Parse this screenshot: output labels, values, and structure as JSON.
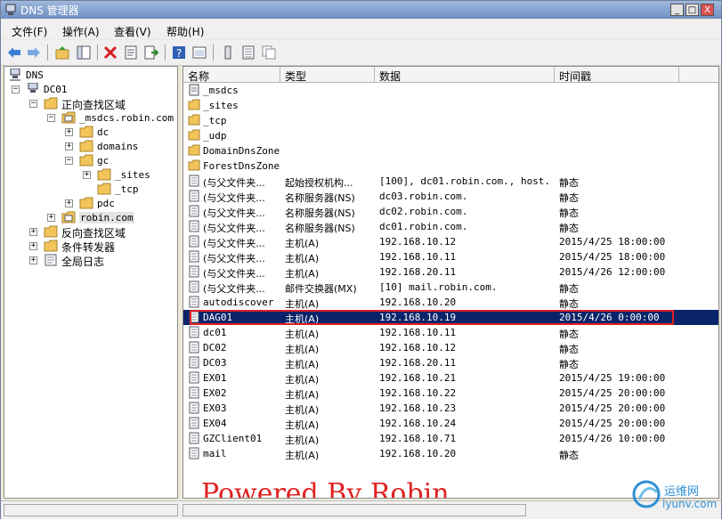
{
  "window": {
    "title": "DNS 管理器",
    "buttons": [
      "_",
      "□",
      "X"
    ]
  },
  "menubar": [
    "文件(F)",
    "操作(A)",
    "查看(V)",
    "帮助(H)"
  ],
  "toolbar_icons": [
    "back-icon",
    "forward-icon",
    "up-folder-icon",
    "show-tree-icon",
    "delete-icon",
    "properties-icon",
    "export-icon",
    "help-icon",
    "console-icon",
    "server-icon",
    "list-icon",
    "copy-icon"
  ],
  "tree": {
    "root": "DNS",
    "server": "DC01",
    "forward_zones": "正向查找区域",
    "msdcs": "_msdcs.robin.com",
    "dc": "dc",
    "domains": "domains",
    "gc": "gc",
    "gc_sites": "_sites",
    "gc_tcp": "_tcp",
    "pdc": "pdc",
    "robin": "robin.com",
    "reverse_zones": "反向查找区域",
    "conditional": "条件转发器",
    "global_logs": "全局日志"
  },
  "list": {
    "headers": [
      "名称",
      "类型",
      "数据",
      "时间戳"
    ],
    "rows": [
      {
        "kind": "folder-special",
        "name": "_msdcs",
        "type": "",
        "data": "",
        "ts": ""
      },
      {
        "kind": "folder",
        "name": "_sites",
        "type": "",
        "data": "",
        "ts": ""
      },
      {
        "kind": "folder",
        "name": "_tcp",
        "type": "",
        "data": "",
        "ts": ""
      },
      {
        "kind": "folder",
        "name": "_udp",
        "type": "",
        "data": "",
        "ts": ""
      },
      {
        "kind": "folder",
        "name": "DomainDnsZones",
        "type": "",
        "data": "",
        "ts": ""
      },
      {
        "kind": "folder",
        "name": "ForestDnsZones",
        "type": "",
        "data": "",
        "ts": ""
      },
      {
        "kind": "record",
        "name": "(与父文件夹...",
        "type": "起始授权机构...",
        "data": "[100], dc01.robin.com., host...",
        "ts": "静态"
      },
      {
        "kind": "record",
        "name": "(与父文件夹...",
        "type": "名称服务器(NS)",
        "data": "dc03.robin.com.",
        "ts": "静态"
      },
      {
        "kind": "record",
        "name": "(与父文件夹...",
        "type": "名称服务器(NS)",
        "data": "dc02.robin.com.",
        "ts": "静态"
      },
      {
        "kind": "record",
        "name": "(与父文件夹...",
        "type": "名称服务器(NS)",
        "data": "dc01.robin.com.",
        "ts": "静态"
      },
      {
        "kind": "record",
        "name": "(与父文件夹...",
        "type": "主机(A)",
        "data": "192.168.10.12",
        "ts": "2015/4/25 18:00:00"
      },
      {
        "kind": "record",
        "name": "(与父文件夹...",
        "type": "主机(A)",
        "data": "192.168.10.11",
        "ts": "2015/4/25 18:00:00"
      },
      {
        "kind": "record",
        "name": "(与父文件夹...",
        "type": "主机(A)",
        "data": "192.168.20.11",
        "ts": "2015/4/26 12:00:00"
      },
      {
        "kind": "record",
        "name": "(与父文件夹...",
        "type": "邮件交换器(MX)",
        "data": "[10]  mail.robin.com.",
        "ts": "静态"
      },
      {
        "kind": "record",
        "name": "autodiscover",
        "type": "主机(A)",
        "data": "192.168.10.20",
        "ts": "静态"
      },
      {
        "kind": "record",
        "name": "DAG01",
        "type": "主机(A)",
        "data": "192.168.10.19",
        "ts": "2015/4/26 0:00:00",
        "selected": true
      },
      {
        "kind": "record",
        "name": "dc01",
        "type": "主机(A)",
        "data": "192.168.10.11",
        "ts": "静态"
      },
      {
        "kind": "record",
        "name": "DC02",
        "type": "主机(A)",
        "data": "192.168.10.12",
        "ts": "静态"
      },
      {
        "kind": "record",
        "name": "DC03",
        "type": "主机(A)",
        "data": "192.168.20.11",
        "ts": "静态"
      },
      {
        "kind": "record",
        "name": "EX01",
        "type": "主机(A)",
        "data": "192.168.10.21",
        "ts": "2015/4/25 19:00:00"
      },
      {
        "kind": "record",
        "name": "EX02",
        "type": "主机(A)",
        "data": "192.168.10.22",
        "ts": "2015/4/25 20:00:00"
      },
      {
        "kind": "record",
        "name": "EX03",
        "type": "主机(A)",
        "data": "192.168.10.23",
        "ts": "2015/4/25 20:00:00"
      },
      {
        "kind": "record",
        "name": "EX04",
        "type": "主机(A)",
        "data": "192.168.10.24",
        "ts": "2015/4/25 20:00:00"
      },
      {
        "kind": "record",
        "name": "GZClient01",
        "type": "主机(A)",
        "data": "192.168.10.71",
        "ts": "2015/4/26 10:00:00"
      },
      {
        "kind": "record",
        "name": "mail",
        "type": "主机(A)",
        "data": "192.168.10.20",
        "ts": "静态"
      }
    ]
  },
  "watermark": "Powered By Robin",
  "logo": {
    "cn": "运维网",
    "en": "iyunv.com"
  },
  "colors": {
    "selection": "#0a246a",
    "highlight_border": "#e02020",
    "folder": "#f2c45a"
  }
}
